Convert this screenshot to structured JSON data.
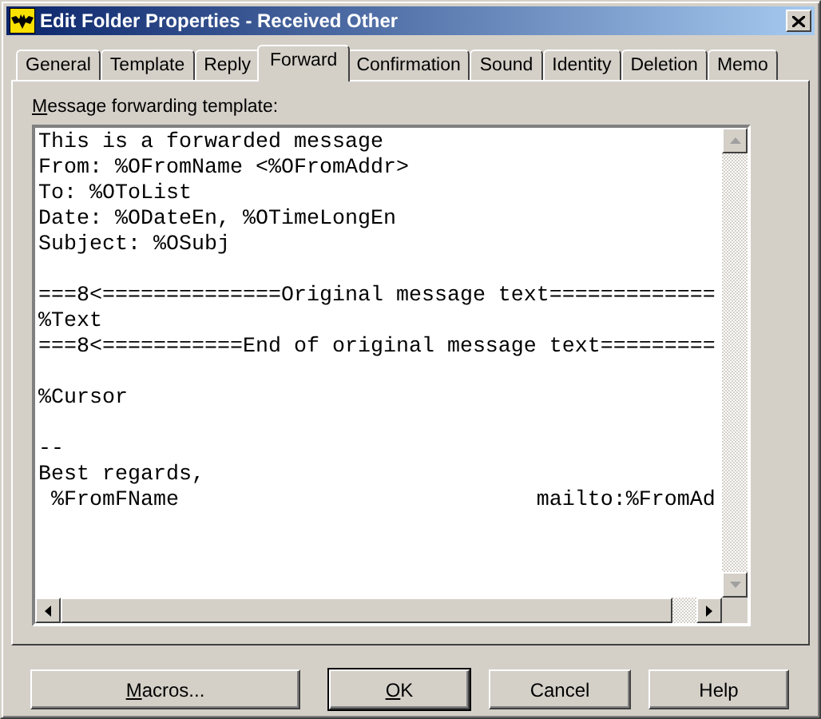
{
  "window": {
    "title": "Edit Folder Properties - Received Other"
  },
  "tabs": [
    {
      "label": "General",
      "selected": false
    },
    {
      "label": "Template",
      "selected": false
    },
    {
      "label": "Reply",
      "selected": false
    },
    {
      "label": "Forward",
      "selected": true
    },
    {
      "label": "Confirmation",
      "selected": false
    },
    {
      "label": "Sound",
      "selected": false
    },
    {
      "label": "Identity",
      "selected": false
    },
    {
      "label": "Deletion",
      "selected": false
    },
    {
      "label": "Memo",
      "selected": false
    }
  ],
  "template": {
    "label": "Message forwarding template:",
    "label_mnemonic": true,
    "text": "This is a forwarded message\nFrom: %OFromName <%OFromAddr>\nTo: %OToList\nDate: %ODateEn, %OTimeLongEn\nSubject: %OSubj\n\n===8<==============Original message text=============\n%Text\n===8<===========End of original message text=========\n\n%Cursor\n\n--\nBest regards,\n %FromFName                            mailto:%FromAd"
  },
  "buttons": [
    {
      "label": "Macros...",
      "mnemonic": true,
      "default": false
    },
    {
      "label": "OK",
      "mnemonic": true,
      "default": true
    },
    {
      "label": "Cancel",
      "mnemonic": false,
      "default": false
    },
    {
      "label": "Help",
      "mnemonic": false,
      "default": false
    }
  ]
}
